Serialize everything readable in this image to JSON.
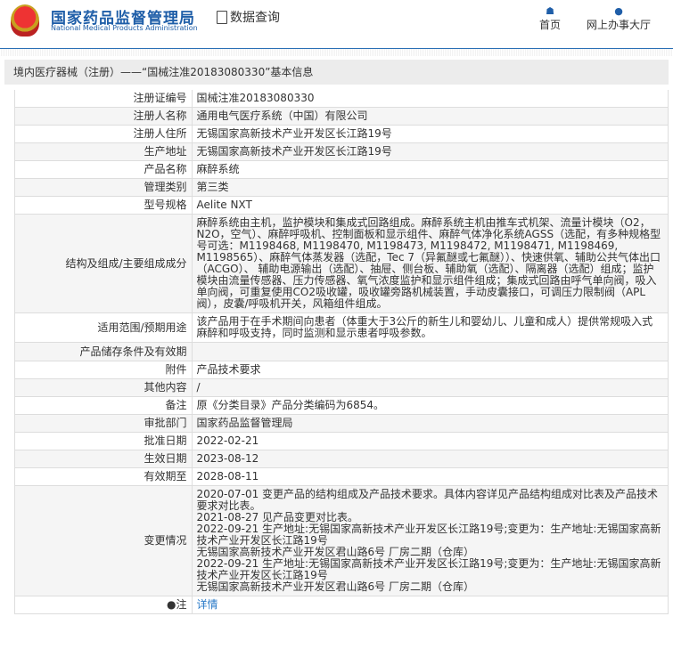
{
  "header": {
    "logo_cn": "国家药品监督管理局",
    "logo_en": "National Medical Products Administration",
    "data_query": "数据查询",
    "nav": [
      {
        "label": "首页",
        "icon": "home-icon"
      },
      {
        "label": "网上办事大厅",
        "icon": "user-icon"
      }
    ]
  },
  "breadcrumb": "境内医疗器械（注册）——“国械注准20183080330”基本信息",
  "rows": [
    {
      "label": "注册证编号",
      "value": "国械注准20183080330"
    },
    {
      "label": "注册人名称",
      "value": "通用电气医疗系统（中国）有限公司"
    },
    {
      "label": "注册人住所",
      "value": "无锡国家高新技术产业开发区长江路19号"
    },
    {
      "label": "生产地址",
      "value": "无锡国家高新技术产业开发区长江路19号"
    },
    {
      "label": "产品名称",
      "value": "麻醉系统"
    },
    {
      "label": "管理类别",
      "value": "第三类"
    },
    {
      "label": "型号规格",
      "value": "Aelite NXT"
    },
    {
      "label": "结构及组成/主要组成成分",
      "value": "麻醉系统由主机，监护模块和集成式回路组成。麻醉系统主机由推车式机架、流量计模块（O2，N2O，空气）、麻醉呼吸机、控制面板和显示组件、麻醉气体净化系统AGSS（选配，有多种规格型号可选：M1198468, M1198470, M1198473, M1198472, M1198471, M1198469, M1198565）、麻醉气体蒸发器（选配，Tec 7（异氟醚或七氟醚））、快速供氧、辅助公共气体出口（ACGO）、 辅助电源输出（选配）、抽屉、侧台板、辅助氧（选配）、隔离器（选配）组成；监护模块由流量传感器、压力传感器、氧气浓度监护和显示组件组成；集成式回路由呼气单向阀，吸入单向阀，可重复使用CO2吸收罐，吸收罐旁路机械装置，手动皮囊接口，可调压力限制阀（APL阀），皮囊/呼吸机开关，风箱组件组成。"
    },
    {
      "label": "适用范围/预期用途",
      "value": "该产品用于在手术期间向患者（体重大于3公斤的新生儿和婴幼儿、儿童和成人）提供常规吸入式麻醉和呼吸支持，同时监测和显示患者呼吸参数。"
    },
    {
      "label": "产品储存条件及有效期",
      "value": ""
    },
    {
      "label": "附件",
      "value": "产品技术要求"
    },
    {
      "label": "其他内容",
      "value": "/"
    },
    {
      "label": "备注",
      "value": "原《分类目录》产品分类编码为6854。"
    },
    {
      "label": "审批部门",
      "value": "国家药品监督管理局"
    },
    {
      "label": "批准日期",
      "value": "2022-02-21"
    },
    {
      "label": "生效日期",
      "value": "2023-08-12"
    },
    {
      "label": "有效期至",
      "value": "2028-08-11"
    }
  ],
  "changes": {
    "label": "变更情况",
    "lines": [
      "2020-07-01 变更产品的结构组成及产品技术要求。具体内容详见产品结构组成对比表及产品技术要求对比表。",
      "2021-08-27 见产品变更对比表。",
      "2022-09-21 生产地址:无锡国家高新技术产业开发区长江路19号;变更为：生产地址:无锡国家高新技术产业开发区长江路19号",
      "无锡国家高新技术产业开发区君山路6号 厂房二期（仓库）",
      "2022-09-21 生产地址:无锡国家高新技术产业开发区长江路19号;变更为：生产地址:无锡国家高新技术产业开发区长江路19号",
      "无锡国家高新技术产业开发区君山路6号 厂房二期（仓库）"
    ]
  },
  "note": {
    "label": "注",
    "link": "详情"
  }
}
